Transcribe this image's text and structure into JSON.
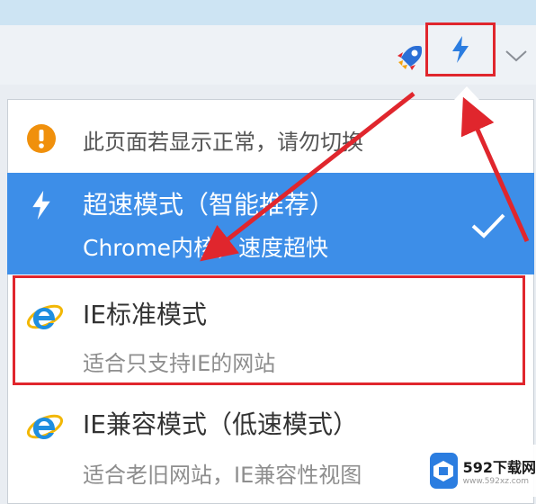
{
  "toolbar": {
    "rocket_icon": "rocket-icon",
    "bolt_icon": "lightning-bolt-icon",
    "chevron_icon": "chevron-down-icon"
  },
  "menu": {
    "notice": {
      "icon": "warning-icon",
      "text": "此页面若显示正常，请勿切换"
    },
    "items": [
      {
        "icon": "lightning-bolt-icon",
        "title": "超速模式（智能推荐）",
        "subtitle": "Chrome内核，速度超快",
        "selected": true
      },
      {
        "icon": "ie-icon",
        "title": "IE标准模式",
        "subtitle": "适合只支持IE的网站",
        "selected": false
      },
      {
        "icon": "ie-icon",
        "title": "IE兼容模式（低速模式）",
        "subtitle": "适合老旧网站，IE兼容性视图",
        "selected": false
      }
    ]
  },
  "watermark": {
    "name": "592下载网",
    "url": "www.592xz.com"
  },
  "colors": {
    "selected_bg": "#3d8ee8",
    "annotation_red": "#e0262d",
    "notice_orange": "#f0900c",
    "ie_blue": "#1f8ee0",
    "ie_gold": "#f2b705"
  }
}
